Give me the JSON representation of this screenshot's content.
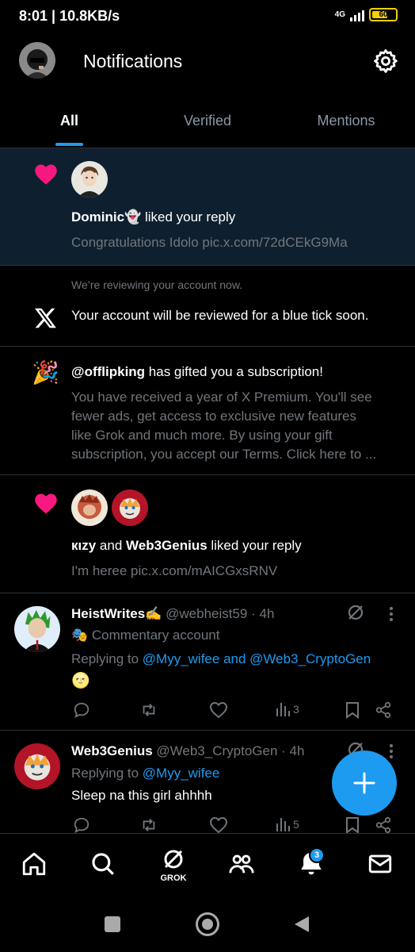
{
  "status_bar": {
    "time_speed": "8:01 | 10.8KB/s",
    "network": "4G",
    "battery": "60"
  },
  "header": {
    "title": "Notifications"
  },
  "tabs": [
    {
      "label": "All"
    },
    {
      "label": "Verified"
    },
    {
      "label": "Mentions"
    }
  ],
  "notifications": {
    "n1": {
      "user": "Dominic",
      "user_emoji": "👻",
      "action": " liked your reply",
      "preview": "Congratulations Idolo pic.x.com/72dCEkG9Ma"
    },
    "n2": {
      "sub": "We’re reviewing your account now.",
      "text": "Your account will be reviewed for a blue tick soon."
    },
    "n3": {
      "emoji": "🎉",
      "user": "@offlipking",
      "action": " has gifted you a subscription!",
      "lines": [
        "You have received a year of X Premium. You'll see",
        "fewer ads, get access to exclusive new features",
        "like Grok and much more. By using your gift",
        "subscription, you accept our Terms. Click here to ..."
      ]
    },
    "n4": {
      "user1": "кιzy",
      "and": " and ",
      "user2": "Web3Genius",
      "action": " liked your reply",
      "preview": "I'm hereе pic.x.com/mAICGxsRNV"
    }
  },
  "posts": [
    {
      "name": "HeistWrites",
      "name_emoji": "✍️",
      "handle": "@webheist59",
      "time": " · 4h",
      "commentary_emoji": "🎭",
      "commentary": "Commentary account",
      "replying_prefix": "Replying to ",
      "replying_to": "@Myy_wifee and @Web3_CryptoGen",
      "body": "🌝",
      "views": "3"
    },
    {
      "name": "Web3Genius",
      "handle": "@Web3_CryptoGen",
      "time": " · 4h",
      "replying_prefix": "Replying to ",
      "replying_to": "@Myy_wifee",
      "body": "Sleep na this girl ahhhh",
      "views": "5"
    }
  ],
  "bottom_nav": {
    "grok_label": "GROK",
    "notification_badge": "3"
  },
  "colors": {
    "accent": "#1d9bf0",
    "like": "#f91880",
    "highlight_bg": "#0e2030"
  },
  "icons": [
    "settings-gear-icon",
    "heart-icon",
    "x-logo-icon",
    "party-popper-icon",
    "grok-icon",
    "reply-icon",
    "retweet-icon",
    "like-icon",
    "views-icon",
    "bookmark-icon",
    "share-icon",
    "compose-plus-icon",
    "home-icon",
    "search-icon",
    "communities-icon",
    "bell-icon",
    "mail-icon"
  ]
}
